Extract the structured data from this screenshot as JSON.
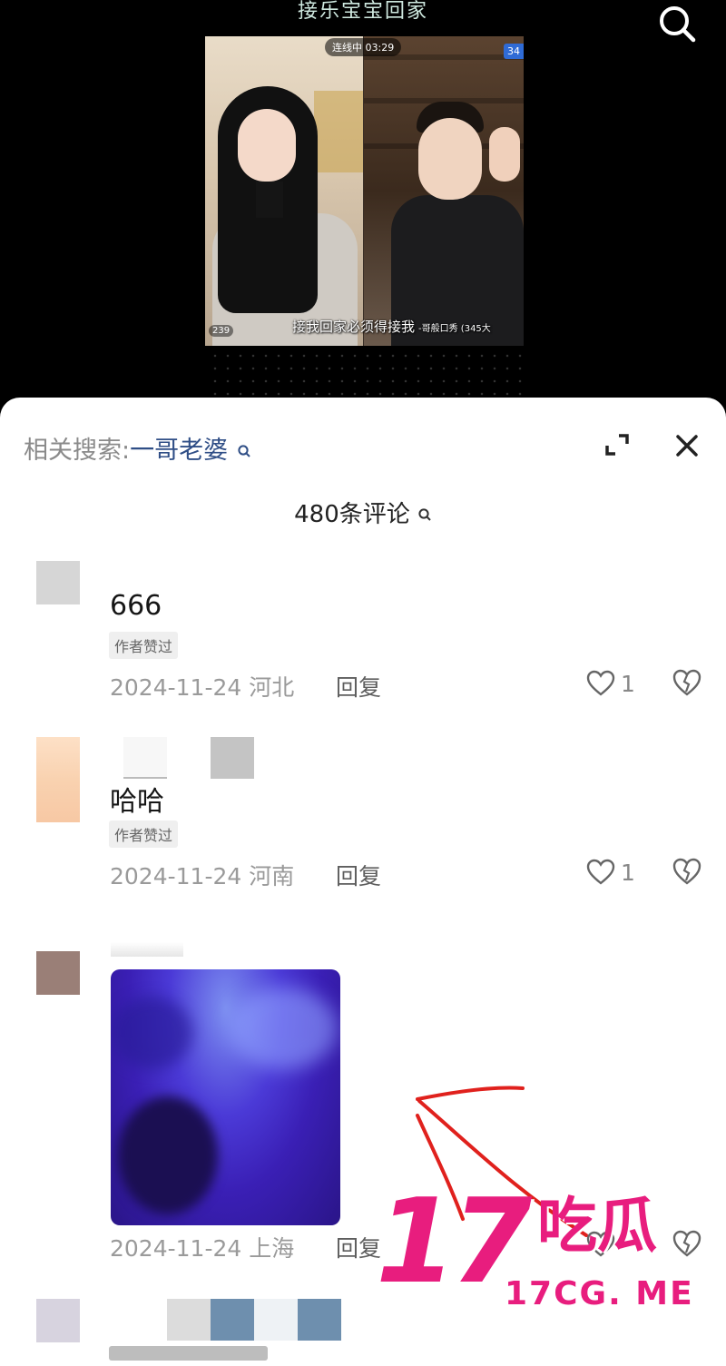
{
  "video": {
    "title": "接乐宝宝回家",
    "timer": "连线中 03:29",
    "corner_badge": "34",
    "viewer_count": "239",
    "subtitle": "接我回家必须得接我",
    "subtitle_small": "-哥般口秀 (345大",
    "search_icon": "search-icon"
  },
  "sheet": {
    "related_prefix": "相关搜索:",
    "related_term": "一哥老婆",
    "comment_count_title": "480条评论",
    "expand_icon": "expand-icon",
    "close_icon": "close-icon"
  },
  "comments": [
    {
      "text": "666",
      "tag": "作者赞过",
      "date": "2024-11-24",
      "location": "河北",
      "reply": "回复",
      "likes": "1"
    },
    {
      "text": "哈哈",
      "tag": "作者赞过",
      "date": "2024-11-24",
      "location": "河南",
      "reply": "回复",
      "likes": "1"
    },
    {
      "date": "2024-11-24",
      "location": "上海",
      "reply": "回复"
    }
  ],
  "watermark": {
    "number": "17",
    "chars": "吃瓜",
    "url": "17CG. ME"
  },
  "colors": {
    "accent_link": "#2f4e86",
    "watermark": "#e81d7e",
    "meta_gray": "#9a9a9a"
  }
}
